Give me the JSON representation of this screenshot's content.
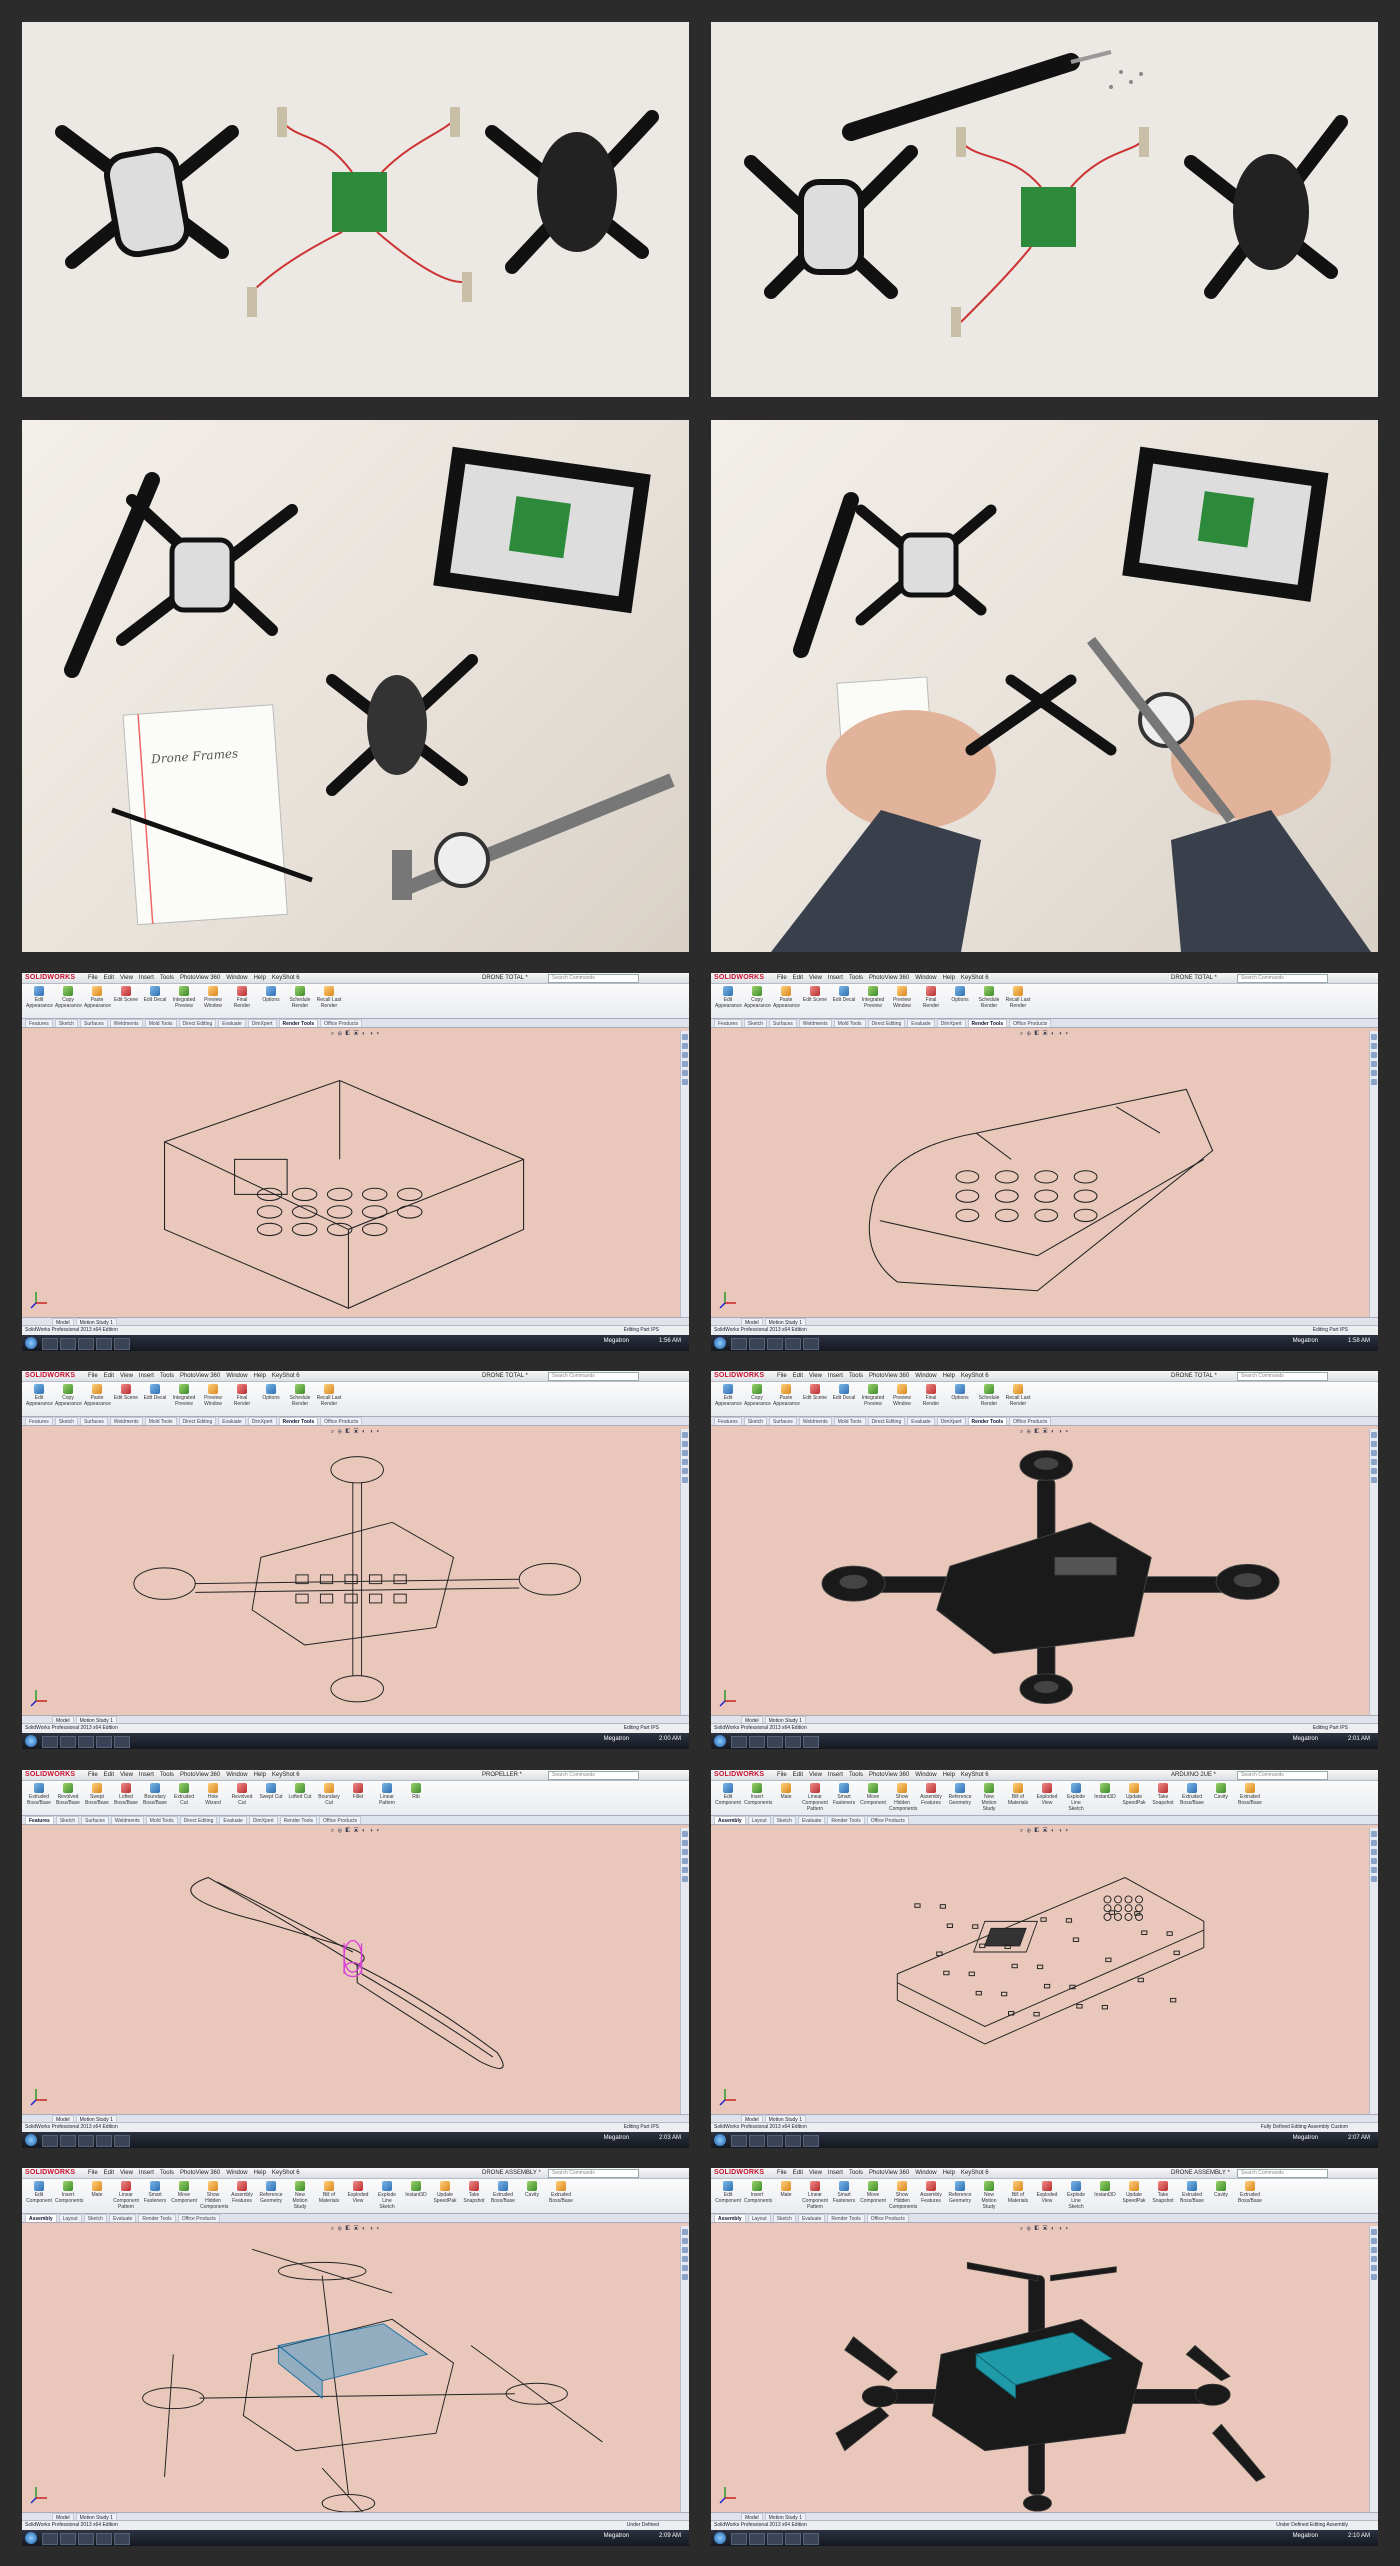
{
  "photos": [
    {
      "id": "photo-1",
      "subject": "disassembled-drone-parts"
    },
    {
      "id": "photo-2",
      "subject": "disassembled-drone-with-screwdriver"
    },
    {
      "id": "photo-3",
      "subject": "parts-with-notepad-and-caliper"
    },
    {
      "id": "photo-4",
      "subject": "measuring-frame-with-caliper"
    }
  ],
  "notepad_text": "Drone Frames",
  "solidworks": {
    "logo": "SOLIDWORKS",
    "menus": [
      "File",
      "Edit",
      "View",
      "Insert",
      "Tools",
      "PhotoView 360",
      "Window",
      "Help",
      "KeyShot 6"
    ],
    "search_placeholder": "Search Commands",
    "statusbar_left": "SolidWorks Professional 2013 x64 Edition",
    "model_tabs": [
      "Model",
      "Motion Study 1"
    ],
    "taskbar_user": "Megatron",
    "render_tools": [
      "Edit Appearance",
      "Copy Appearance",
      "Paste Appearance",
      "Edit Scene",
      "Edit Decal",
      "Integrated Preview",
      "Preview Window",
      "Final Render",
      "Options",
      "Schedule Render",
      "Recall Last Render"
    ],
    "part_tabs": [
      "Features",
      "Sketch",
      "Surfaces",
      "Weldments",
      "Mold Tools",
      "Direct Editing",
      "Evaluate",
      "DimXpert",
      "Render Tools",
      "Office Products"
    ],
    "feature_tools": [
      "Extruded Boss/Base",
      "Revolved Boss/Base",
      "Swept Boss/Base",
      "Lofted Boss/Base",
      "Boundary Boss/Base",
      "Extruded Cut",
      "Hole Wizard",
      "Revolved Cut",
      "Swept Cut",
      "Lofted Cut",
      "Boundary Cut",
      "Fillet",
      "Linear Pattern",
      "Rib",
      "Draft",
      "Shell",
      "Wrap",
      "Intersect",
      "Mirror",
      "Reference Geometry",
      "Curves",
      "Instant3D"
    ],
    "assembly_tabs": [
      "Assembly",
      "Layout",
      "Sketch",
      "Evaluate",
      "Render Tools",
      "Office Products"
    ],
    "assembly_tools": [
      "Edit Component",
      "Insert Components",
      "Mate",
      "Linear Component Pattern",
      "Smart Fasteners",
      "Move Component",
      "Show Hidden Components",
      "Assembly Features",
      "Reference Geometry",
      "New Motion Study",
      "Bill of Materials",
      "Exploded View",
      "Explode Line Sketch",
      "Instant3D",
      "Update SpeedPak",
      "Take Snapshot",
      "Extruded Boss/Base",
      "Cavity",
      "Extruded Boss/Base"
    ],
    "windows": [
      {
        "id": "sw-1",
        "doc": "DRONE TOTAL *",
        "status": "Editing Part",
        "units": "IPS",
        "time": "1:56 AM",
        "ribbon": "render",
        "tabset": "part",
        "active_tab": "Render Tools",
        "model": "body-outline"
      },
      {
        "id": "sw-2",
        "doc": "DRONE TOTAL *",
        "status": "Editing Part",
        "units": "IPS",
        "time": "1:58 AM",
        "ribbon": "render",
        "tabset": "part",
        "active_tab": "Render Tools",
        "model": "body-shell"
      },
      {
        "id": "sw-3",
        "doc": "DRONE TOTAL *",
        "status": "Editing Part",
        "units": "IPS",
        "time": "2:00 AM",
        "ribbon": "render",
        "tabset": "part",
        "active_tab": "Render Tools",
        "model": "frame-wire"
      },
      {
        "id": "sw-4",
        "doc": "DRONE TOTAL *",
        "status": "Editing Part",
        "units": "IPS",
        "time": "2:01 AM",
        "ribbon": "render",
        "tabset": "part",
        "active_tab": "Render Tools",
        "model": "frame-solid"
      },
      {
        "id": "sw-5",
        "doc": "PROPELLER *",
        "status": "Editing Part",
        "units": "IPS",
        "time": "2:03 AM",
        "ribbon": "features",
        "tabset": "part",
        "active_tab": "Features",
        "model": "propeller"
      },
      {
        "id": "sw-6",
        "doc": "ARDUINO 2UE *",
        "status": "Editing Assembly",
        "units": "Custom",
        "time": "2:07 AM",
        "extra": "Fully Defined",
        "ribbon": "assembly",
        "tabset": "assembly",
        "active_tab": "Assembly",
        "model": "pcb"
      },
      {
        "id": "sw-7",
        "doc": "DRONE ASSEMBLY *",
        "status": "Under Defined",
        "units": "",
        "time": "2:09 AM",
        "ribbon": "assembly",
        "tabset": "assembly",
        "active_tab": "Assembly",
        "model": "assembly-wire"
      },
      {
        "id": "sw-8",
        "doc": "DRONE ASSEMBLY *",
        "status": "Editing Assembly",
        "units": "",
        "time": "2:10 AM",
        "extra": "Under Defined",
        "ribbon": "assembly",
        "tabset": "assembly",
        "active_tab": "Assembly",
        "model": "assembly-solid"
      }
    ]
  }
}
